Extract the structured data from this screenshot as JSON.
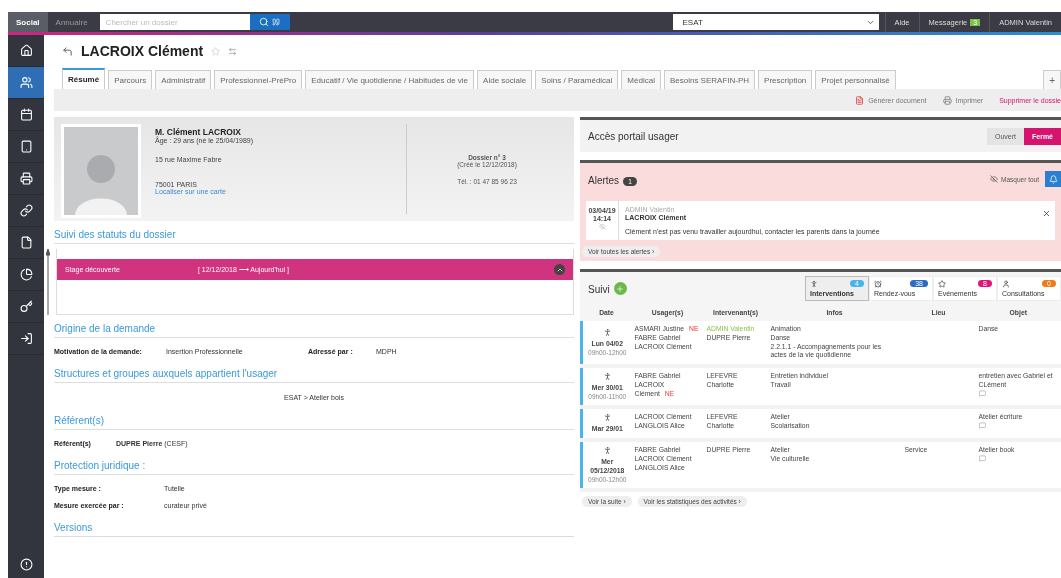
{
  "topbar": {
    "app_tabs": [
      {
        "label": "Social",
        "selected": true
      },
      {
        "label": "Annuaire",
        "selected": false
      }
    ],
    "search": {
      "placeholder": "Chercher un dossier"
    },
    "establishment": "ESAT",
    "help": "Aide",
    "messages": {
      "label": "Messagerie",
      "count": "3"
    },
    "user": "ADMIN Valentin"
  },
  "sidebar": {
    "items": [
      {
        "selected": false
      },
      {
        "selected": true
      },
      {
        "selected": false
      },
      {
        "selected": false
      },
      {
        "selected": false
      },
      {
        "selected": false
      },
      {
        "selected": false
      },
      {
        "selected": false
      },
      {
        "selected": false
      },
      {
        "selected": false
      }
    ]
  },
  "title": "LACROIX Clément",
  "tabs": [
    {
      "label": "Résumé",
      "selected": true
    },
    {
      "label": "Parcours",
      "selected": false
    },
    {
      "label": "Administratif",
      "selected": false
    },
    {
      "label": "Professionnel-PréPro",
      "selected": false
    },
    {
      "label": "Educatif / Vie quotidienne / Habitudes de vie",
      "selected": false
    },
    {
      "label": "Aide sociale",
      "selected": false
    },
    {
      "label": "Soins / Paramédical",
      "selected": false
    },
    {
      "label": "Médical",
      "selected": false
    },
    {
      "label": "Besoins SERAFIN-PH",
      "selected": false
    },
    {
      "label": "Prescription",
      "selected": false
    },
    {
      "label": "Projet personnalisé",
      "selected": false
    }
  ],
  "add_tab": "+",
  "actions": {
    "generate": "Générer document",
    "print": "Imprimer",
    "delete": "Supprimer le dossie"
  },
  "profile": {
    "name": "M. Clément LACROIX",
    "age": "Âge : 29 ans (né le 25/04/1989)",
    "street": "15 rue Maxime Fabre",
    "city": "75001 PARIS",
    "map_link": "Localiser sur une carte",
    "dossier": "Dossier n° 3",
    "created": "(Créé le 12/12/2018)",
    "phone": "Tél. : 01 47 85 96 23"
  },
  "status_section": {
    "title": "Suivi des statuts du dossier",
    "statuses": [
      {
        "label": "Stage découverte",
        "period": "[ 12/12/2018 ⟶ Aujourd'hui ]",
        "expanded": true
      }
    ]
  },
  "origin": {
    "title": "Origine de la demande",
    "fields": [
      {
        "label": "Motivation de la demande:",
        "value": "Insertion Professionnelle"
      },
      {
        "label": "Adressé par :",
        "value": "MDPH"
      }
    ]
  },
  "structures": {
    "title": "Structures et groupes auxquels appartient l'usager",
    "value": "ESAT > Atelier bois"
  },
  "referents": {
    "title": "Référent(s)",
    "label": "Référent(s)",
    "value": "**DUPRE Pierre** (CESF)"
  },
  "protection": {
    "title": "Protection juridique :",
    "fields": [
      {
        "label": "Type mesure :",
        "value": "Tutelle"
      },
      {
        "label": "Mesure exercée par :",
        "value": "curateur privé"
      }
    ]
  },
  "versions": {
    "title": "Versions"
  },
  "portal": {
    "title": "Accès portail usager",
    "options": [
      {
        "label": "Ouvert",
        "selected": false
      },
      {
        "label": "Fermé",
        "selected": true
      }
    ]
  },
  "alerts": {
    "title": "Alertes",
    "count": "1",
    "hide_all": "Masquer tout",
    "items": [
      {
        "date": "03/04/19",
        "time": "14:14",
        "author": "ADMIN Valentin",
        "subject": "LACROIX Clément",
        "message": "Clément n'est pas venu travailler aujourdhui, contacter les parents dans la journée"
      }
    ],
    "see_all": "Voir toutes les alertes ›"
  },
  "suivi": {
    "title": "Suivi",
    "filters": [
      {
        "label": "Interventions",
        "count": "4",
        "color": "#4ab3e8",
        "selected": true
      },
      {
        "label": "Rendez-vous",
        "count": "38",
        "color": "#2a6cc0",
        "selected": false
      },
      {
        "label": "Evénements",
        "count": "8",
        "color": "#e0157a",
        "selected": false
      },
      {
        "label": "Consultations",
        "count": "0",
        "color": "#f07a1a",
        "selected": false
      }
    ],
    "columns": [
      "Date",
      "Usager(s)",
      "Intervenant(s)",
      "Infos",
      "Lieu",
      "Objet"
    ],
    "rows": [
      {
        "day": "Lun 04/02",
        "time": "09h00-12h00",
        "users": [
          {
            "name": "ASMARI Justine",
            "tag": "NE"
          },
          {
            "name": "FABRE Gabriel"
          },
          {
            "name": "LACROIX Clément"
          }
        ],
        "staff": [
          {
            "name": "ADMIN Valentin",
            "highlighted": true
          },
          {
            "name": "DUPRE Pierre",
            "highlighted": false
          }
        ],
        "infos": [
          "Animation",
          "Danse",
          "2.2.1.1 - Accompagnements pour les actes de la vie quotidienne"
        ],
        "place": "",
        "object": "Danse",
        "comment": false
      },
      {
        "day": "Mer 30/01",
        "time": "09h00-11h00",
        "users": [
          {
            "name": "FABRE Gabriel"
          },
          {
            "name": "LACROIX Clément",
            "tag": "NE"
          }
        ],
        "staff": [
          {
            "name": "LEFEVRE Charlotte",
            "highlighted": false
          }
        ],
        "infos": [
          "Entretien individuel",
          "Travail"
        ],
        "place": "",
        "object": "entretien avec Gabriel et CLément",
        "comment": true
      },
      {
        "day": "Mar 29/01",
        "time": "",
        "users": [
          {
            "name": "LACROIX Clément"
          },
          {
            "name": "LANGLOIS Alice"
          }
        ],
        "staff": [
          {
            "name": "LEFEVRE Charlotte",
            "highlighted": false
          }
        ],
        "infos": [
          "Atelier",
          "Scolarisation"
        ],
        "place": "",
        "object": "Atelier écriture",
        "comment": true
      },
      {
        "day": "Mer 05/12/2018",
        "time": "09h00-12h00",
        "users": [
          {
            "name": "FABRE Gabriel"
          },
          {
            "name": "LACROIX Clément"
          },
          {
            "name": "LANGLOIS Alice"
          }
        ],
        "staff": [
          {
            "name": "DUPRE Pierre",
            "highlighted": false
          }
        ],
        "infos": [
          "Atelier",
          "Vie culturelle"
        ],
        "place": "Service",
        "object": "Atelier book",
        "comment": true
      }
    ],
    "more": "Voir la suite ›",
    "stats": "Voir les statistiques des activités ›"
  }
}
